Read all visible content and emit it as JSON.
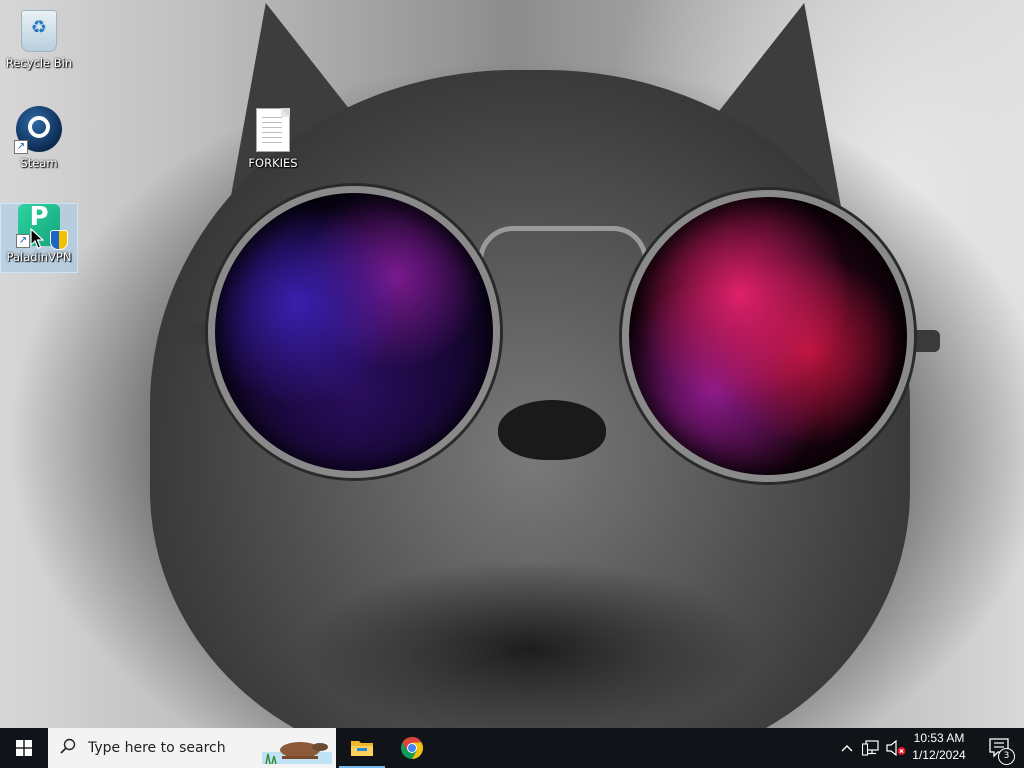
{
  "desktop": {
    "icons": [
      {
        "label": "Recycle Bin",
        "icon": "recycle-bin-icon"
      },
      {
        "label": "Steam",
        "icon": "steam-icon"
      },
      {
        "label": "PaladinVPN",
        "icon": "paladinvpn-icon"
      },
      {
        "label": "FORKIES",
        "icon": "text-document-icon"
      }
    ],
    "selected_icon": "PaladinVPN",
    "wallpaper": "cat-with-galaxy-sunglasses"
  },
  "taskbar": {
    "start_icon": "windows-logo-icon",
    "search_placeholder": "Type here to search",
    "pinned": [
      {
        "name": "File Explorer",
        "icon": "folder-icon",
        "active": true
      },
      {
        "name": "Google Chrome",
        "icon": "chrome-icon",
        "active": false
      }
    ],
    "tray": {
      "chevron_icon": "chevron-up-icon",
      "network_icon": "network-icon",
      "volume_icon": "volume-muted-icon",
      "time": "10:53 AM",
      "date": "1/12/2024",
      "notification_count": "3"
    }
  },
  "colors": {
    "taskbar_bg": "#101418",
    "search_bg": "#f3f3f3",
    "selection_bg": "#99c9ef",
    "windows_blue": "#ffffff",
    "chrome_red": "#db4437",
    "chrome_yellow": "#f4c20d",
    "chrome_green": "#0f9d58",
    "chrome_blue": "#4285f4"
  }
}
